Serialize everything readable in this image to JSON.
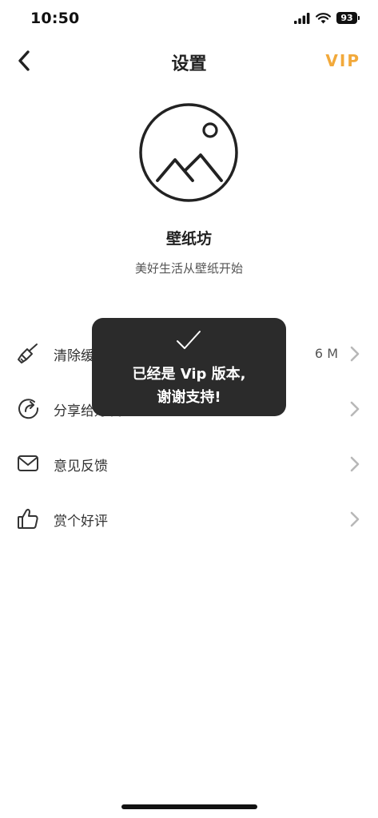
{
  "status_bar": {
    "time": "10:50",
    "battery": "93",
    "icons": [
      "signal-icon",
      "wifi-icon",
      "battery-icon"
    ]
  },
  "nav": {
    "title": "设置",
    "vip_label": "VIP",
    "back_icon": "chevron-left-icon"
  },
  "app": {
    "name": "壁纸坊",
    "slogan": "美好生活从壁纸开始",
    "logo_icon": "landscape-image-icon"
  },
  "settings": {
    "items": [
      {
        "label": "清除缓存",
        "value": "6 M",
        "icon": "brush-icon"
      },
      {
        "label": "分享给好友",
        "value": "",
        "icon": "share-icon"
      },
      {
        "label": "意见反馈",
        "value": "",
        "icon": "mail-icon"
      },
      {
        "label": "赏个好评",
        "value": "",
        "icon": "thumbs-up-icon"
      }
    ]
  },
  "toast": {
    "line1": "已经是 Vip 版本,",
    "line2": "谢谢支持!",
    "icon": "checkmark-icon"
  },
  "colors": {
    "accent": "#F2A93B",
    "toast_bg": "#2B2B2B",
    "text": "#333333",
    "chevron": "#B8B8B8"
  }
}
